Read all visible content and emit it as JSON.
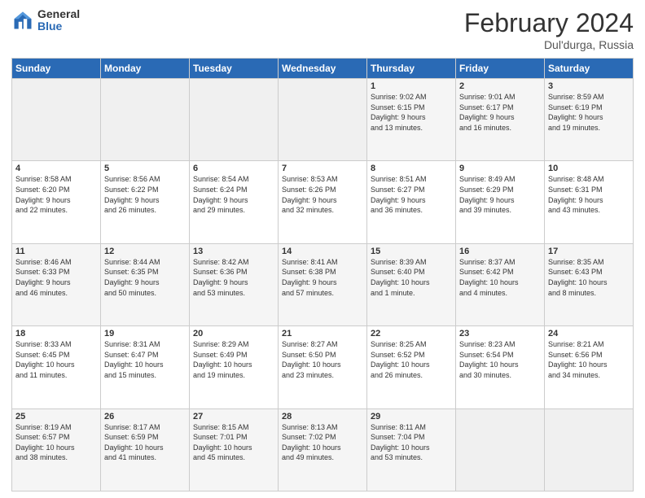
{
  "logo": {
    "general": "General",
    "blue": "Blue"
  },
  "title": "February 2024",
  "subtitle": "Dul'durga, Russia",
  "days_of_week": [
    "Sunday",
    "Monday",
    "Tuesday",
    "Wednesday",
    "Thursday",
    "Friday",
    "Saturday"
  ],
  "weeks": [
    [
      {
        "day": "",
        "info": ""
      },
      {
        "day": "",
        "info": ""
      },
      {
        "day": "",
        "info": ""
      },
      {
        "day": "",
        "info": ""
      },
      {
        "day": "1",
        "info": "Sunrise: 9:02 AM\nSunset: 6:15 PM\nDaylight: 9 hours\nand 13 minutes."
      },
      {
        "day": "2",
        "info": "Sunrise: 9:01 AM\nSunset: 6:17 PM\nDaylight: 9 hours\nand 16 minutes."
      },
      {
        "day": "3",
        "info": "Sunrise: 8:59 AM\nSunset: 6:19 PM\nDaylight: 9 hours\nand 19 minutes."
      }
    ],
    [
      {
        "day": "4",
        "info": "Sunrise: 8:58 AM\nSunset: 6:20 PM\nDaylight: 9 hours\nand 22 minutes."
      },
      {
        "day": "5",
        "info": "Sunrise: 8:56 AM\nSunset: 6:22 PM\nDaylight: 9 hours\nand 26 minutes."
      },
      {
        "day": "6",
        "info": "Sunrise: 8:54 AM\nSunset: 6:24 PM\nDaylight: 9 hours\nand 29 minutes."
      },
      {
        "day": "7",
        "info": "Sunrise: 8:53 AM\nSunset: 6:26 PM\nDaylight: 9 hours\nand 32 minutes."
      },
      {
        "day": "8",
        "info": "Sunrise: 8:51 AM\nSunset: 6:27 PM\nDaylight: 9 hours\nand 36 minutes."
      },
      {
        "day": "9",
        "info": "Sunrise: 8:49 AM\nSunset: 6:29 PM\nDaylight: 9 hours\nand 39 minutes."
      },
      {
        "day": "10",
        "info": "Sunrise: 8:48 AM\nSunset: 6:31 PM\nDaylight: 9 hours\nand 43 minutes."
      }
    ],
    [
      {
        "day": "11",
        "info": "Sunrise: 8:46 AM\nSunset: 6:33 PM\nDaylight: 9 hours\nand 46 minutes."
      },
      {
        "day": "12",
        "info": "Sunrise: 8:44 AM\nSunset: 6:35 PM\nDaylight: 9 hours\nand 50 minutes."
      },
      {
        "day": "13",
        "info": "Sunrise: 8:42 AM\nSunset: 6:36 PM\nDaylight: 9 hours\nand 53 minutes."
      },
      {
        "day": "14",
        "info": "Sunrise: 8:41 AM\nSunset: 6:38 PM\nDaylight: 9 hours\nand 57 minutes."
      },
      {
        "day": "15",
        "info": "Sunrise: 8:39 AM\nSunset: 6:40 PM\nDaylight: 10 hours\nand 1 minute."
      },
      {
        "day": "16",
        "info": "Sunrise: 8:37 AM\nSunset: 6:42 PM\nDaylight: 10 hours\nand 4 minutes."
      },
      {
        "day": "17",
        "info": "Sunrise: 8:35 AM\nSunset: 6:43 PM\nDaylight: 10 hours\nand 8 minutes."
      }
    ],
    [
      {
        "day": "18",
        "info": "Sunrise: 8:33 AM\nSunset: 6:45 PM\nDaylight: 10 hours\nand 11 minutes."
      },
      {
        "day": "19",
        "info": "Sunrise: 8:31 AM\nSunset: 6:47 PM\nDaylight: 10 hours\nand 15 minutes."
      },
      {
        "day": "20",
        "info": "Sunrise: 8:29 AM\nSunset: 6:49 PM\nDaylight: 10 hours\nand 19 minutes."
      },
      {
        "day": "21",
        "info": "Sunrise: 8:27 AM\nSunset: 6:50 PM\nDaylight: 10 hours\nand 23 minutes."
      },
      {
        "day": "22",
        "info": "Sunrise: 8:25 AM\nSunset: 6:52 PM\nDaylight: 10 hours\nand 26 minutes."
      },
      {
        "day": "23",
        "info": "Sunrise: 8:23 AM\nSunset: 6:54 PM\nDaylight: 10 hours\nand 30 minutes."
      },
      {
        "day": "24",
        "info": "Sunrise: 8:21 AM\nSunset: 6:56 PM\nDaylight: 10 hours\nand 34 minutes."
      }
    ],
    [
      {
        "day": "25",
        "info": "Sunrise: 8:19 AM\nSunset: 6:57 PM\nDaylight: 10 hours\nand 38 minutes."
      },
      {
        "day": "26",
        "info": "Sunrise: 8:17 AM\nSunset: 6:59 PM\nDaylight: 10 hours\nand 41 minutes."
      },
      {
        "day": "27",
        "info": "Sunrise: 8:15 AM\nSunset: 7:01 PM\nDaylight: 10 hours\nand 45 minutes."
      },
      {
        "day": "28",
        "info": "Sunrise: 8:13 AM\nSunset: 7:02 PM\nDaylight: 10 hours\nand 49 minutes."
      },
      {
        "day": "29",
        "info": "Sunrise: 8:11 AM\nSunset: 7:04 PM\nDaylight: 10 hours\nand 53 minutes."
      },
      {
        "day": "",
        "info": ""
      },
      {
        "day": "",
        "info": ""
      }
    ]
  ]
}
